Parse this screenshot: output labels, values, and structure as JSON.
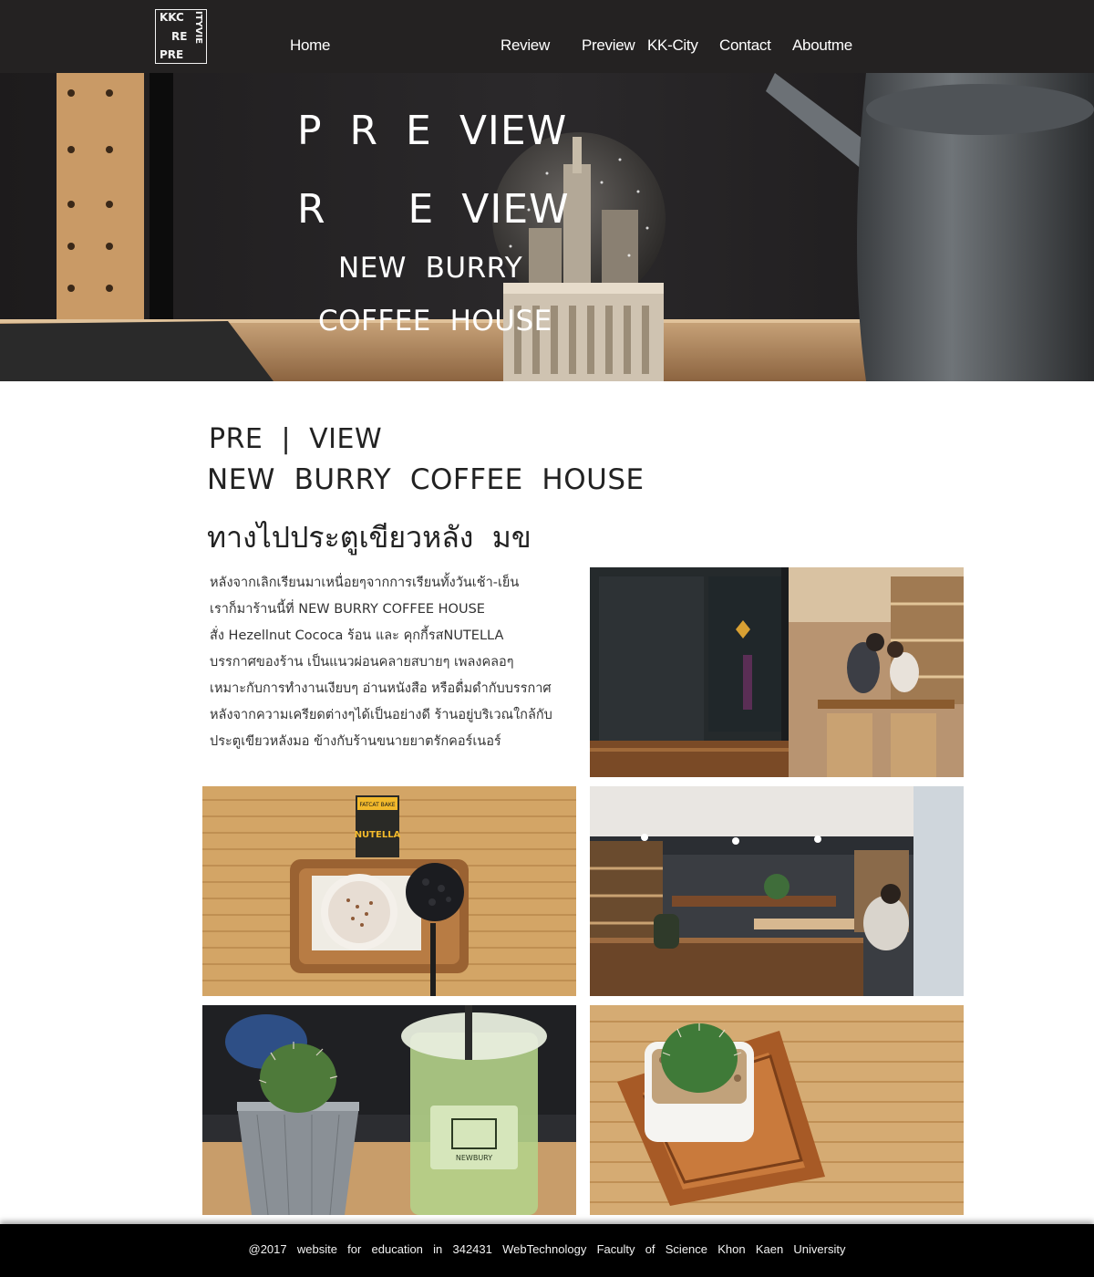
{
  "nav": {
    "logo": {
      "line1": "KKC",
      "line2": "RE",
      "line3": "PRE",
      "vertical": "ITYVIE"
    },
    "links": [
      "Home",
      "Review",
      "Preview",
      "KK-City",
      "Contact",
      "Aboutme"
    ]
  },
  "hero": {
    "line1": "P  R  E  VIEW",
    "line2": "R      E  VIEW",
    "line3": "NEW  BURRY",
    "line4": "COFFEE  HOUSE"
  },
  "content": {
    "title1": "PRE  |  VIEW",
    "title2": "NEW  BURRY  COFFEE  HOUSE",
    "title3": "ทางไปประตูเขียวหลัง  มข",
    "paragraph": [
      "หลังจากเลิกเรียนมาเหนื่อยๆจากการเรียนทั้งวันเช้า-เย็น",
      "เราก็มาร้านนี้ที่  NEW  BURRY  COFFEE  HOUSE",
      "สั่ง  Hezellnut  Cococa  ร้อน   และ  คุกกี้รสNUTELLA",
      "บรรกาศของร้าน  เป็นแนวผ่อนคลายสบายๆ  เพลงคลอๆ",
      "เหมาะกับการทำงานเงียบๆ  อ่านหนังสือ  หรือดื่มดำกับบรรกาศ",
      "หลังจากความเครียดต่างๆได้เป็นอย่างดี  ร้านอยู่บริเวณใกล้กับ",
      "ประตูเขียวหลังมอ  ข้างกับร้านขนายยาตรักคอร์เนอร์"
    ]
  },
  "photos": {
    "cookie_label": "NUTELLA",
    "cookie_brand": "FATCAT BAKE",
    "cup_brand": "NEWBURY"
  },
  "footer": {
    "text": "@2017  website  for  education  in  342431  WebTechnology  Faculty  of  Science  Khon  Kaen  University"
  },
  "colors": {
    "nav_bg": "#242222",
    "footer_bg": "#000000",
    "text": "#222222"
  }
}
